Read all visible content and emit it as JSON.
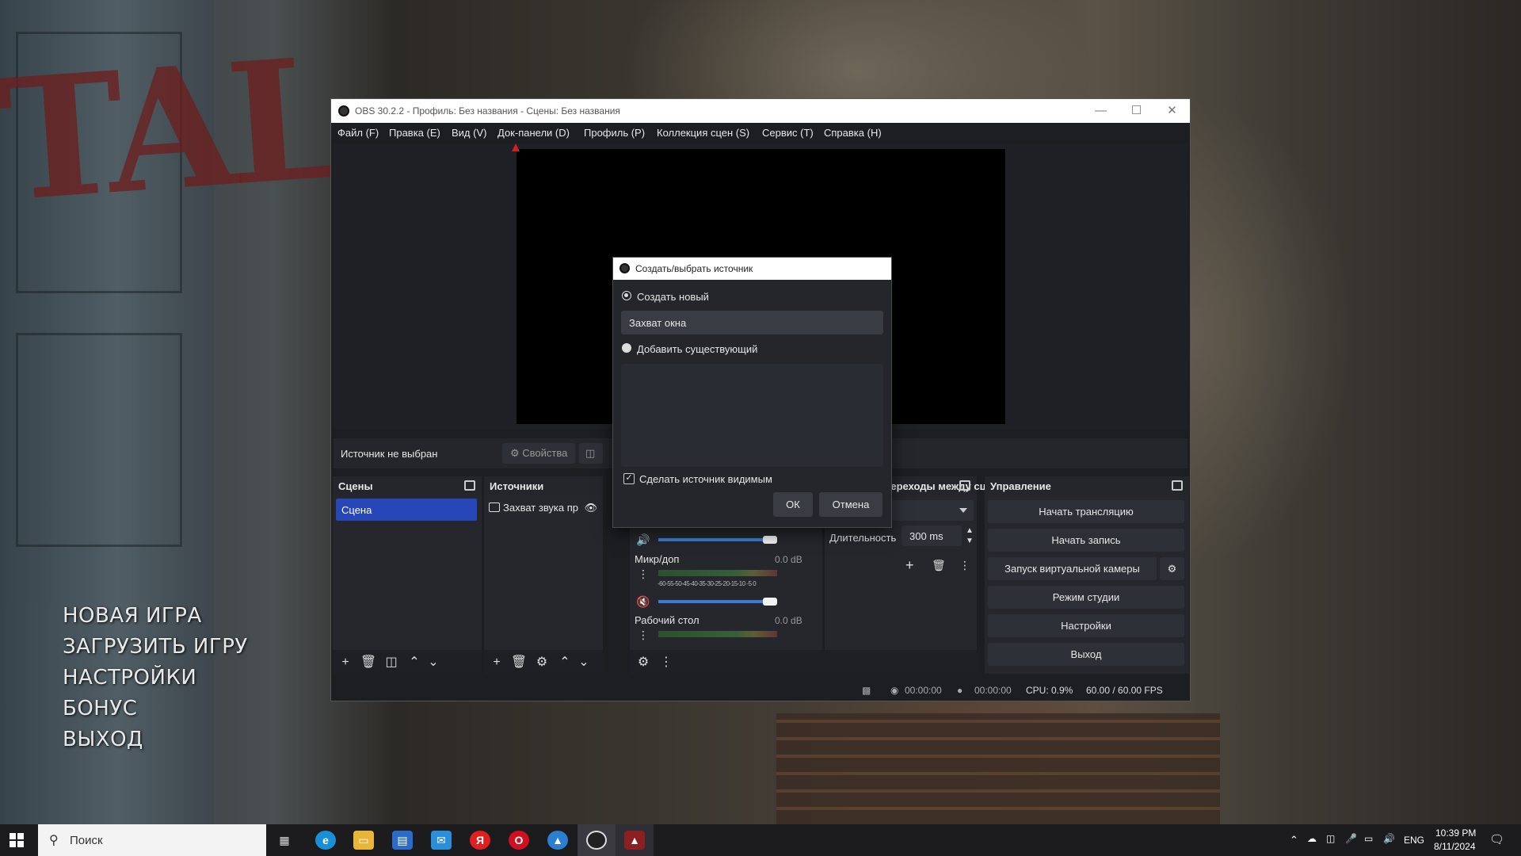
{
  "game_menu": [
    "НОВАЯ ИГРА",
    "ЗАГРУЗИТЬ ИГРУ",
    "НАСТРОЙКИ",
    "БОНУС",
    "ВЫХОД"
  ],
  "obs": {
    "title": "OBS 30.2.2 - Профиль: Без названия - Сцены: Без названия",
    "menu": [
      "Файл (F)",
      "Правка (E)",
      "Вид (V)",
      "Док-панели (D)",
      "Профиль (P)",
      "Коллекция сцен (S)",
      "Сервис (T)",
      "Справка (H)"
    ],
    "source_toolbar": {
      "no_source": "Источник не выбран",
      "properties": "Свойства"
    },
    "scenes": {
      "title": "Сцены",
      "items": [
        "Сцена"
      ]
    },
    "sources": {
      "title": "Источники",
      "items": [
        "Захват звука пр"
      ]
    },
    "mixer": {
      "scale": "-60-55-50-45-40-35-30-25-20-15-10 -5 0",
      "channels": [
        {
          "name": "Микр/доп",
          "db": "0.0 dB"
        },
        {
          "name": "Рабочий стол",
          "db": "0.0 dB"
        }
      ]
    },
    "transitions": {
      "title": "Переходы между сце...",
      "duration_label": "Длительность",
      "duration_value": "300 ms"
    },
    "controls": {
      "title": "Управление",
      "buttons": [
        "Начать трансляцию",
        "Начать запись",
        "Запуск виртуальной камеры",
        "Режим студии",
        "Настройки",
        "Выход"
      ]
    },
    "status": {
      "stream_time": "00:00:00",
      "record_time": "00:00:00",
      "cpu": "CPU: 0.9%",
      "fps": "60.00 / 60.00 FPS"
    }
  },
  "dialog": {
    "title": "Создать/выбрать источник",
    "create_new": "Создать новый",
    "name_value": "Захват окна",
    "add_existing": "Добавить существующий",
    "make_visible": "Сделать источник видимым",
    "ok": "ОК",
    "cancel": "Отмена"
  },
  "taskbar": {
    "search_placeholder": "Поиск",
    "lang": "ENG",
    "time": "10:39 PM",
    "date": "8/11/2024"
  },
  "colors": {
    "accent": "#2746b8",
    "obs_bg": "#1d1e22"
  }
}
